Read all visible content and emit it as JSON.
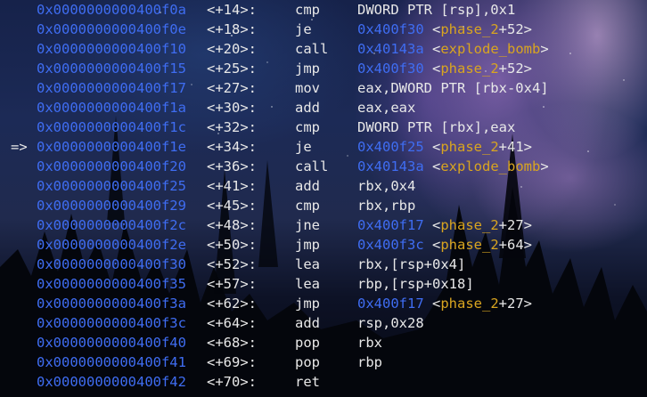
{
  "theme": {
    "address_color": "#3f6df2",
    "symbol_color": "#d9a520",
    "text_color": "#e8e8e8"
  },
  "disassembly": [
    {
      "arrow": "",
      "address": "0x0000000000400f0a",
      "offset": "<+14>:",
      "mnemonic": "cmp",
      "operand": "DWORD PTR [rsp],0x1",
      "target": "",
      "symbol": "",
      "symbol_suffix": ""
    },
    {
      "arrow": "",
      "address": "0x0000000000400f0e",
      "offset": "<+18>:",
      "mnemonic": "je",
      "operand": "",
      "target": "0x400f30",
      "symbol": "phase_2",
      "symbol_suffix": "+52>"
    },
    {
      "arrow": "",
      "address": "0x0000000000400f10",
      "offset": "<+20>:",
      "mnemonic": "call",
      "operand": "",
      "target": "0x40143a",
      "symbol": "explode_bomb",
      "symbol_suffix": ">"
    },
    {
      "arrow": "",
      "address": "0x0000000000400f15",
      "offset": "<+25>:",
      "mnemonic": "jmp",
      "operand": "",
      "target": "0x400f30",
      "symbol": "phase_2",
      "symbol_suffix": "+52>"
    },
    {
      "arrow": "",
      "address": "0x0000000000400f17",
      "offset": "<+27>:",
      "mnemonic": "mov",
      "operand": "eax,DWORD PTR [rbx-0x4]",
      "target": "",
      "symbol": "",
      "symbol_suffix": ""
    },
    {
      "arrow": "",
      "address": "0x0000000000400f1a",
      "offset": "<+30>:",
      "mnemonic": "add",
      "operand": "eax,eax",
      "target": "",
      "symbol": "",
      "symbol_suffix": ""
    },
    {
      "arrow": "",
      "address": "0x0000000000400f1c",
      "offset": "<+32>:",
      "mnemonic": "cmp",
      "operand": "DWORD PTR [rbx],eax",
      "target": "",
      "symbol": "",
      "symbol_suffix": ""
    },
    {
      "arrow": "=>",
      "address": "0x0000000000400f1e",
      "offset": "<+34>:",
      "mnemonic": "je",
      "operand": "",
      "target": "0x400f25",
      "symbol": "phase_2",
      "symbol_suffix": "+41>"
    },
    {
      "arrow": "",
      "address": "0x0000000000400f20",
      "offset": "<+36>:",
      "mnemonic": "call",
      "operand": "",
      "target": "0x40143a",
      "symbol": "explode_bomb",
      "symbol_suffix": ">"
    },
    {
      "arrow": "",
      "address": "0x0000000000400f25",
      "offset": "<+41>:",
      "mnemonic": "add",
      "operand": "rbx,0x4",
      "target": "",
      "symbol": "",
      "symbol_suffix": ""
    },
    {
      "arrow": "",
      "address": "0x0000000000400f29",
      "offset": "<+45>:",
      "mnemonic": "cmp",
      "operand": "rbx,rbp",
      "target": "",
      "symbol": "",
      "symbol_suffix": ""
    },
    {
      "arrow": "",
      "address": "0x0000000000400f2c",
      "offset": "<+48>:",
      "mnemonic": "jne",
      "operand": "",
      "target": "0x400f17",
      "symbol": "phase_2",
      "symbol_suffix": "+27>"
    },
    {
      "arrow": "",
      "address": "0x0000000000400f2e",
      "offset": "<+50>:",
      "mnemonic": "jmp",
      "operand": "",
      "target": "0x400f3c",
      "symbol": "phase_2",
      "symbol_suffix": "+64>"
    },
    {
      "arrow": "",
      "address": "0x0000000000400f30",
      "offset": "<+52>:",
      "mnemonic": "lea",
      "operand": "rbx,[rsp+0x4]",
      "target": "",
      "symbol": "",
      "symbol_suffix": ""
    },
    {
      "arrow": "",
      "address": "0x0000000000400f35",
      "offset": "<+57>:",
      "mnemonic": "lea",
      "operand": "rbp,[rsp+0x18]",
      "target": "",
      "symbol": "",
      "symbol_suffix": ""
    },
    {
      "arrow": "",
      "address": "0x0000000000400f3a",
      "offset": "<+62>:",
      "mnemonic": "jmp",
      "operand": "",
      "target": "0x400f17",
      "symbol": "phase_2",
      "symbol_suffix": "+27>"
    },
    {
      "arrow": "",
      "address": "0x0000000000400f3c",
      "offset": "<+64>:",
      "mnemonic": "add",
      "operand": "rsp,0x28",
      "target": "",
      "symbol": "",
      "symbol_suffix": ""
    },
    {
      "arrow": "",
      "address": "0x0000000000400f40",
      "offset": "<+68>:",
      "mnemonic": "pop",
      "operand": "rbx",
      "target": "",
      "symbol": "",
      "symbol_suffix": ""
    },
    {
      "arrow": "",
      "address": "0x0000000000400f41",
      "offset": "<+69>:",
      "mnemonic": "pop",
      "operand": "rbp",
      "target": "",
      "symbol": "",
      "symbol_suffix": ""
    },
    {
      "arrow": "",
      "address": "0x0000000000400f42",
      "offset": "<+70>:",
      "mnemonic": "ret",
      "operand": "",
      "target": "",
      "symbol": "",
      "symbol_suffix": ""
    }
  ]
}
